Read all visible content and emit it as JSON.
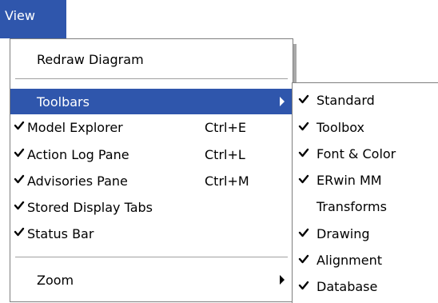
{
  "menubar": {
    "view_label": "View",
    "highlight_color": "#2f56ac"
  },
  "menu": {
    "items": [
      {
        "label": "Redraw Diagram",
        "checked": false,
        "shortcut": "",
        "submenu": false
      },
      {
        "label": "Toolbars",
        "checked": false,
        "shortcut": "",
        "submenu": true,
        "highlighted": true
      },
      {
        "label": "Model Explorer",
        "checked": true,
        "shortcut": "Ctrl+E",
        "submenu": false
      },
      {
        "label": "Action Log Pane",
        "checked": true,
        "shortcut": "Ctrl+L",
        "submenu": false
      },
      {
        "label": "Advisories Pane",
        "checked": true,
        "shortcut": "Ctrl+M",
        "submenu": false
      },
      {
        "label": "Stored Display Tabs",
        "checked": true,
        "shortcut": "",
        "submenu": false
      },
      {
        "label": "Status Bar",
        "checked": true,
        "shortcut": "",
        "submenu": false
      },
      {
        "label": "Zoom",
        "checked": false,
        "shortcut": "",
        "submenu": true
      }
    ]
  },
  "toolbars_submenu": {
    "items": [
      {
        "label": "Standard",
        "checked": true
      },
      {
        "label": "Toolbox",
        "checked": true
      },
      {
        "label": "Font & Color",
        "checked": true
      },
      {
        "label": "ERwin MM",
        "checked": true
      },
      {
        "label": "Transforms",
        "checked": false
      },
      {
        "label": "Drawing",
        "checked": true
      },
      {
        "label": "Alignment",
        "checked": true
      },
      {
        "label": "Database",
        "checked": true
      }
    ]
  },
  "icons": {
    "check": "checkmark-icon",
    "submenu_arrow": "submenu-arrow-icon"
  }
}
